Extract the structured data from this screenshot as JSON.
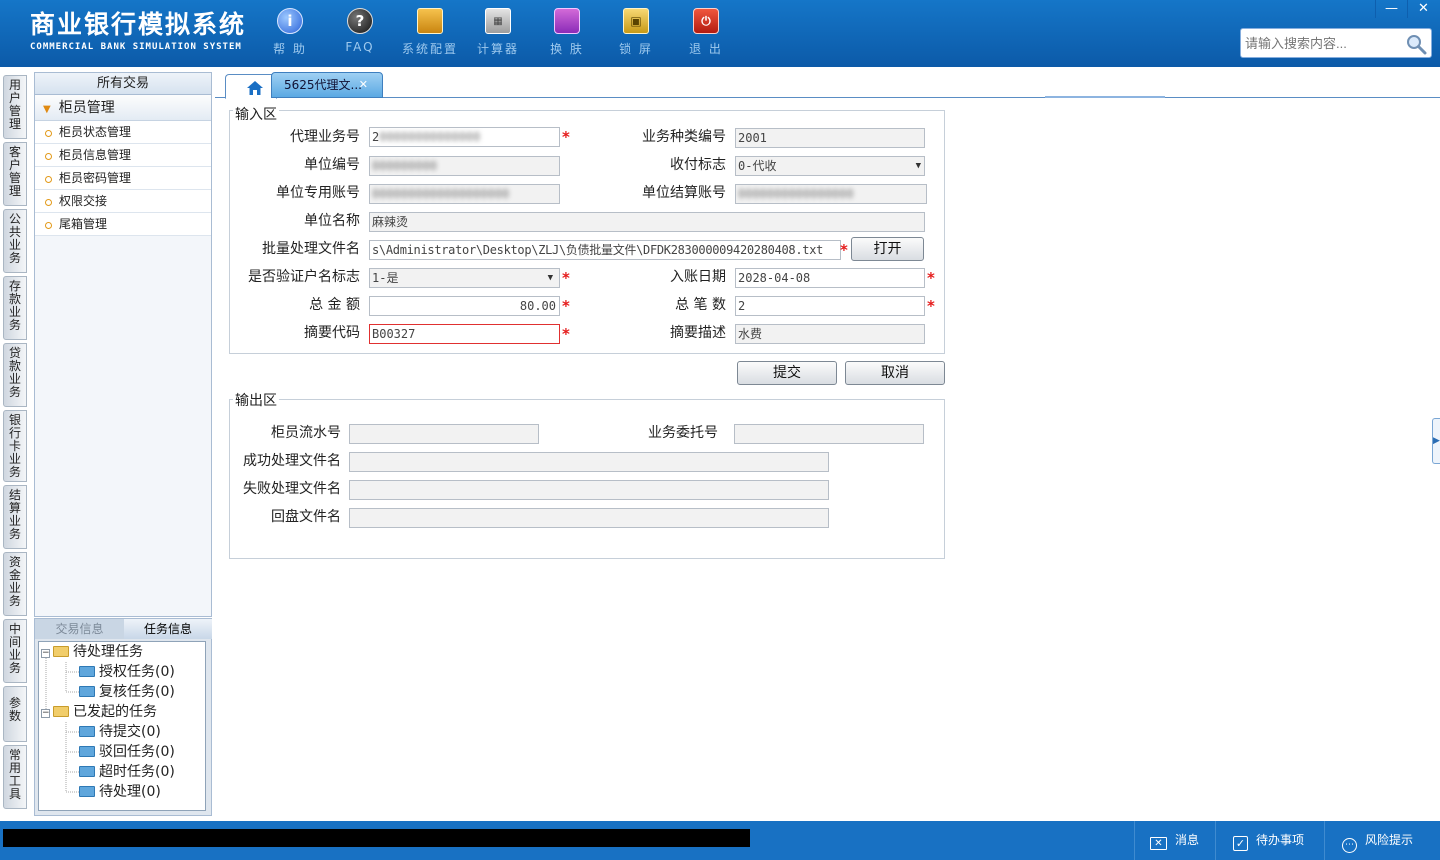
{
  "app": {
    "title_cn": "商业银行模拟系统",
    "title_en": "COMMERCIAL BANK SIMULATION SYSTEM"
  },
  "toolbar": [
    {
      "label": "帮 助",
      "icon": "help-icon"
    },
    {
      "label": "FAQ",
      "icon": "faq-icon"
    },
    {
      "label": "系统配置",
      "icon": "config-icon"
    },
    {
      "label": "计算器",
      "icon": "calculator-icon"
    },
    {
      "label": "换 肤",
      "icon": "skin-icon"
    },
    {
      "label": "锁 屏",
      "icon": "lock-icon"
    },
    {
      "label": "退 出",
      "icon": "exit-icon"
    }
  ],
  "window": {
    "minimize": "—",
    "close": "✕"
  },
  "search": {
    "placeholder": "请输入搜索内容..."
  },
  "vtabs": [
    "用户管理",
    "客户管理",
    "公共业务",
    "存款业务",
    "贷款业务",
    "银行卡业务",
    "结算业务",
    "资金业务",
    "中间业务",
    "参数",
    "常用工具"
  ],
  "sidebar": {
    "header": "所有交易",
    "group": "柜员管理",
    "items": [
      "柜员状态管理",
      "柜员信息管理",
      "柜员密码管理",
      "权限交接",
      "尾箱管理"
    ]
  },
  "taskpanel": {
    "tabs": [
      "交易信息",
      "任务信息"
    ],
    "tree": {
      "pending": "待处理任务",
      "auth": "授权任务(0)",
      "review": "复核任务(0)",
      "initiated": "已发起的任务",
      "to_submit": "待提交(0)",
      "rejected": "驳回任务(0)",
      "timeout": "超时任务(0)",
      "to_process": "待处理(0)"
    }
  },
  "tabs": {
    "current": "5625代理文..."
  },
  "form": {
    "input_legend": "输入区",
    "output_legend": "输出区",
    "labels": {
      "agent_no": "代理业务号",
      "biz_type_no": "业务种类编号",
      "unit_no": "单位编号",
      "pay_flag": "收付标志",
      "unit_account": "单位专用账号",
      "settle_account": "单位结算账号",
      "unit_name": "单位名称",
      "batch_file": "批量处理文件名",
      "verify_name": "是否验证户名标志",
      "post_date": "入账日期",
      "total_amount": "总 金 额",
      "total_count": "总 笔 数",
      "summary_code": "摘要代码",
      "summary_desc": "摘要描述",
      "teller_serial": "柜员流水号",
      "biz_entrust_no": "业务委托号",
      "success_file": "成功处理文件名",
      "fail_file": "失败处理文件名",
      "reply_file": "回盘文件名"
    },
    "values": {
      "agent_no": "2",
      "biz_type_no": "2001",
      "pay_flag": "0-代收",
      "unit_name": "麻辣烫",
      "batch_file": "s\\Administrator\\Desktop\\ZLJ\\负债批量文件\\DFDK283000009420280408.txt",
      "verify_name": "1-是",
      "post_date": "2028-04-08",
      "total_amount": "80.00",
      "total_count": "2",
      "summary_code": "B00327",
      "summary_desc": "水费"
    },
    "buttons": {
      "open": "打开",
      "submit": "提交",
      "cancel": "取消"
    }
  },
  "statusbar": {
    "message": "消息",
    "todo": "待办事项",
    "risk": "风险提示"
  },
  "colors": {
    "header_blue": "#1576c8",
    "required_star": "#e51c1c",
    "error_border": "#e03030"
  }
}
